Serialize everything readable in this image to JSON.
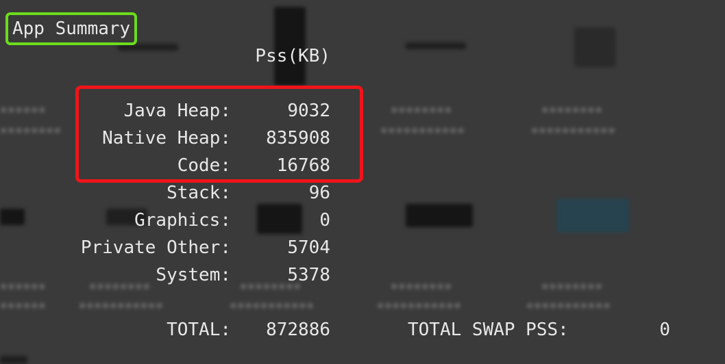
{
  "app_summary": {
    "title": "App Summary",
    "column_header": "Pss(KB)",
    "rows": [
      {
        "label": "Java Heap:",
        "value": "9032"
      },
      {
        "label": "Native Heap:",
        "value": "835908"
      },
      {
        "label": "Code:",
        "value": "16768"
      },
      {
        "label": "Stack:",
        "value": "96"
      },
      {
        "label": "Graphics:",
        "value": "0"
      },
      {
        "label": "Private Other:",
        "value": "5704"
      },
      {
        "label": "System:",
        "value": "5378"
      }
    ],
    "total": {
      "label": "TOTAL:",
      "value": "872886"
    },
    "total_swap": {
      "label": "TOTAL SWAP PSS:",
      "value": "0"
    }
  },
  "annotations": {
    "title_box_color": "#6bdc1c",
    "highlight_box_color": "#f0141a"
  }
}
